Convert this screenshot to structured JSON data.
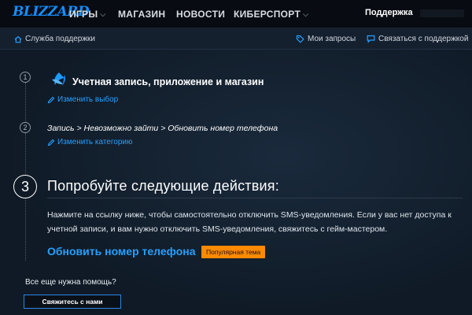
{
  "topnav": {
    "logo": "BLIZZARD",
    "items": [
      {
        "label": "ИГРЫ",
        "dropdown": true
      },
      {
        "label": "МАГАЗИН",
        "dropdown": false
      },
      {
        "label": "НОВОСТИ",
        "dropdown": false
      },
      {
        "label": "КИБЕРСПОРТ",
        "dropdown": true
      }
    ],
    "support_label": "Поддержка"
  },
  "subnav": {
    "support_home": "Служба поддержки",
    "my_tickets": "Мои запросы",
    "contact_support": "Связаться с поддержкой"
  },
  "steps": {
    "step1": {
      "number": "1",
      "title": "Учетная запись, приложение и магазин",
      "edit_label": "Изменить выбор"
    },
    "step2": {
      "number": "2",
      "title": "Запись > Невозможно зайти > Обновить номер телефона",
      "edit_label": "Изменить категорию"
    },
    "step3": {
      "number": "3",
      "title": "Попробуйте следующие действия:",
      "body": "Нажмите на ссылку ниже, чтобы самостоятельно отключить SMS-уведомления. Если у вас нет доступа к учетной записи, и вам нужно отключить SMS-уведомления, свяжитесь с гейм-мастером.",
      "solution_link": "Обновить номер телефона",
      "badge": "Популярная тема"
    }
  },
  "help": {
    "question": "Все еще нужна помощь?",
    "contact_button": "Свяжитесь с нами"
  },
  "colors": {
    "accent": "#26a0ff",
    "logo": "#148eff",
    "badge": "#ff8a00",
    "background": "#0f1a26"
  },
  "icons": {
    "home": "home-icon",
    "tickets": "tag-icon",
    "contact": "chat-icon",
    "edit": "pencil-icon",
    "battlenet": "battlenet-icon"
  }
}
